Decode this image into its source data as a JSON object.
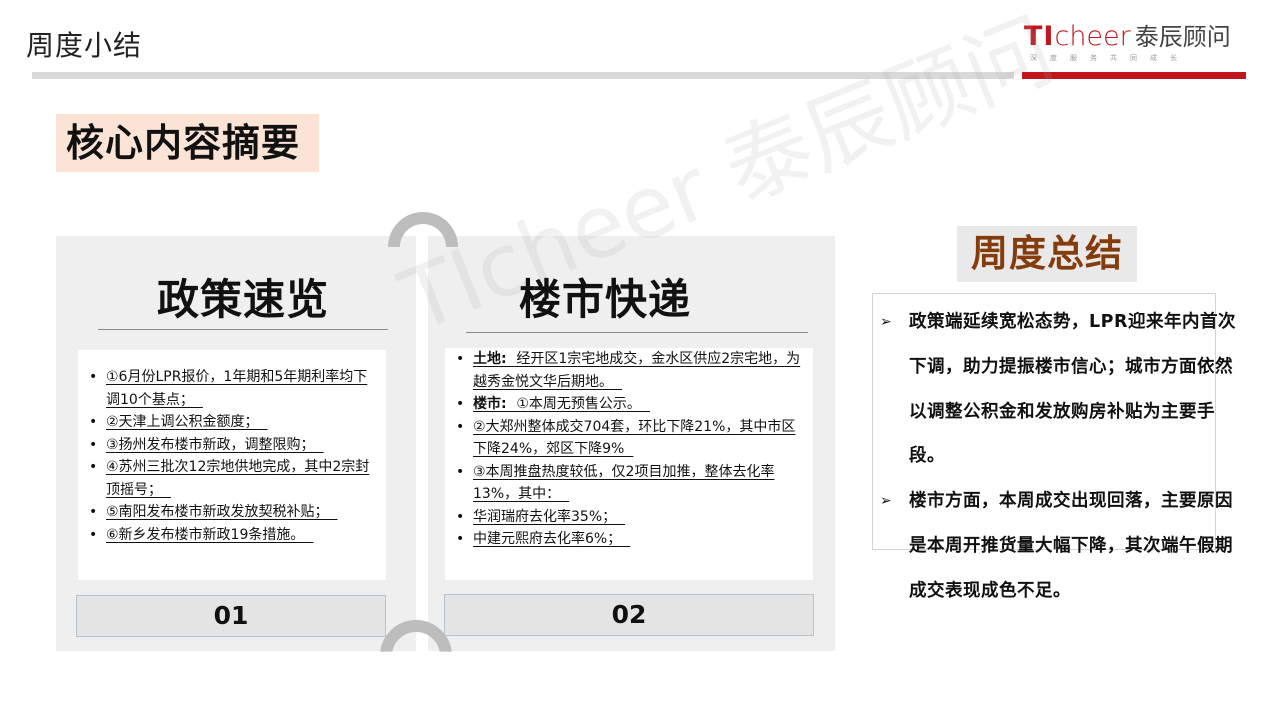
{
  "header": {
    "title": "周度小结",
    "logo": {
      "ti": "TI",
      "cheer": "cheer",
      "cn": "泰辰顾问",
      "sub": "深度服务共同成长"
    },
    "accent_color": "#c0161c"
  },
  "summary_heading": "核心内容摘要",
  "watermark": "TIcheer 泰辰顾问",
  "cards": [
    {
      "title": "政策速览",
      "number": "01",
      "items": [
        "①6月份LPR报价，1年期和5年期利率均下调10个基点；",
        "②天津上调公积金额度；",
        "③扬州发布楼市新政，调整限购；",
        "④苏州三批次12宗地供地完成，其中2宗封顶摇号；",
        "⑤南阳发布楼市新政发放契税补贴；",
        "⑥新乡发布楼市新政19条措施。"
      ]
    },
    {
      "title": "楼市快递",
      "number": "02",
      "items": [
        {
          "label": "土地:",
          "text": "经开区1宗宅地成交，金水区供应2宗宅地，为越秀金悦文华后期地。"
        },
        {
          "label": "楼市:",
          "text": "①本周无预售公示。"
        },
        {
          "label": "",
          "text": "②大郑州整体成交704套，环比下降21%，其中市区下降24%，郊区下降9%"
        },
        {
          "label": "",
          "text": "③本周推盘热度较低，仅2项目加推，整体去化率13%，其中："
        },
        {
          "label": "",
          "text": "华润瑞府去化率35%；"
        },
        {
          "label": "",
          "text": "中建元熙府去化率6%；"
        }
      ]
    }
  ],
  "weekly": {
    "heading": "周度总结",
    "heading_color": "#843c0c",
    "bullet_icon": "arrow-right-icon",
    "points": [
      "政策端延续宽松态势，LPR迎来年内首次下调，助力提振楼市信心；城市方面依然以调整公积金和发放购房补贴为主要手段。",
      "楼市方面，本周成交出现回落，主要原因是本周开推货量大幅下降，其次端午假期成交表现成色不足。"
    ]
  }
}
